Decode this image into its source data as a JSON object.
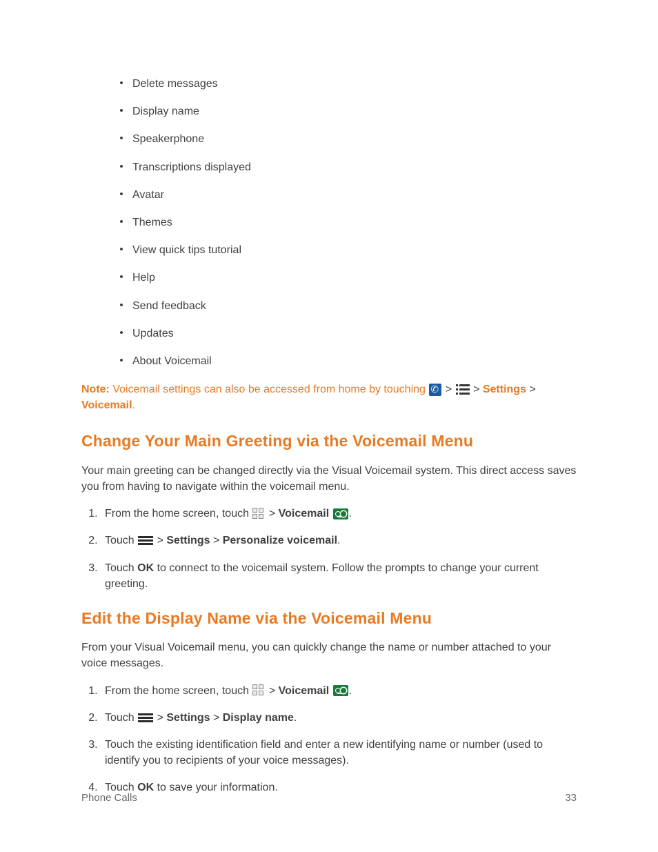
{
  "bullets": [
    "Delete messages",
    "Display name",
    "Speakerphone",
    "Transcriptions displayed",
    "Avatar",
    "Themes",
    "View quick tips tutorial",
    "Help",
    "Send feedback",
    "Updates",
    "About Voicemail"
  ],
  "note": {
    "label": "Note:",
    "text_before": " Voicemail settings can also be accessed from home by touching ",
    "settings": "Settings",
    "voicemail": "Voicemail",
    "gt": ">",
    "period": "."
  },
  "section1": {
    "heading": "Change Your Main Greeting via the Voicemail Menu",
    "intro": "Your main greeting can be changed directly via the Visual Voicemail system. This direct access saves you from having to navigate within the voicemail menu.",
    "step1_a": "From the home screen, touch ",
    "step1_vm": "Voicemail",
    "step2_a": "Touch ",
    "step2_settings": "Settings",
    "step2_personalize": "Personalize voicemail",
    "step3_a": "Touch ",
    "step3_ok": "OK",
    "step3_b": " to connect to the voicemail system. Follow the prompts to change your current greeting."
  },
  "section2": {
    "heading": "Edit the Display Name via the Voicemail Menu",
    "intro": "From your Visual Voicemail menu, you can quickly change the name or number attached to your voice messages.",
    "step1_a": "From the home screen, touch ",
    "step1_vm": "Voicemail",
    "step2_a": "Touch ",
    "step2_settings": "Settings",
    "step2_display": "Display name",
    "step3": "Touch the existing identification field and enter a new identifying name or number (used to identify you to recipients of your voice messages).",
    "step4_a": "Touch ",
    "step4_ok": "OK",
    "step4_b": " to save your information."
  },
  "sym": {
    "gt": " > ",
    "gt_plain": ">",
    "period": "."
  },
  "footer": {
    "left": "Phone Calls",
    "right": "33"
  }
}
